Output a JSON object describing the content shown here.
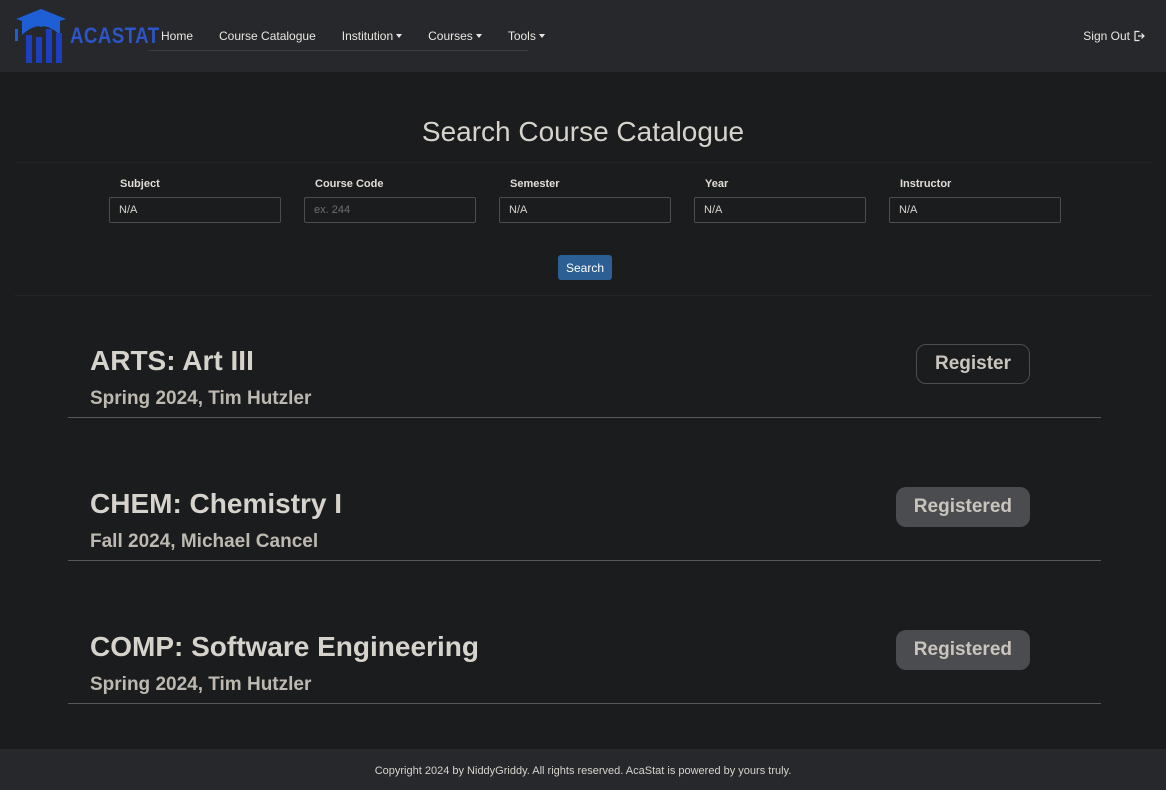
{
  "brand": {
    "name": "ACASTAT",
    "color": "#2d54c9"
  },
  "nav": {
    "links": [
      {
        "label": "Home"
      },
      {
        "label": "Course Catalogue"
      },
      {
        "label": "Institution"
      },
      {
        "label": "Courses"
      },
      {
        "label": "Tools"
      }
    ],
    "signout_label": "Sign Out"
  },
  "search": {
    "title": "Search Course Catalogue",
    "fields": [
      {
        "label": "Subject",
        "value": "N/A",
        "placeholder": ""
      },
      {
        "label": "Course Code",
        "value": "",
        "placeholder": "ex. 244"
      },
      {
        "label": "Semester",
        "value": "N/A",
        "placeholder": ""
      },
      {
        "label": "Year",
        "value": "N/A",
        "placeholder": ""
      },
      {
        "label": "Instructor",
        "value": "N/A",
        "placeholder": ""
      }
    ],
    "button_label": "Search"
  },
  "courses": [
    {
      "title": "ARTS: Art III",
      "subtitle": "Spring 2024, Tim Hutzler",
      "action": "Register"
    },
    {
      "title": "CHEM: Chemistry I",
      "subtitle": "Fall 2024, Michael Cancel",
      "action": "Registered"
    },
    {
      "title": "COMP: Software Engineering",
      "subtitle": "Spring 2024, Tim Hutzler",
      "action": "Registered"
    }
  ],
  "footer": {
    "text": "Copyright 2024 by NiddyGriddy. All rights reserved. AcaStat is powered by yours truly."
  },
  "colors": {
    "accent": "#2c5f94",
    "background": "#1b1c1e",
    "navbar": "#26282b"
  }
}
